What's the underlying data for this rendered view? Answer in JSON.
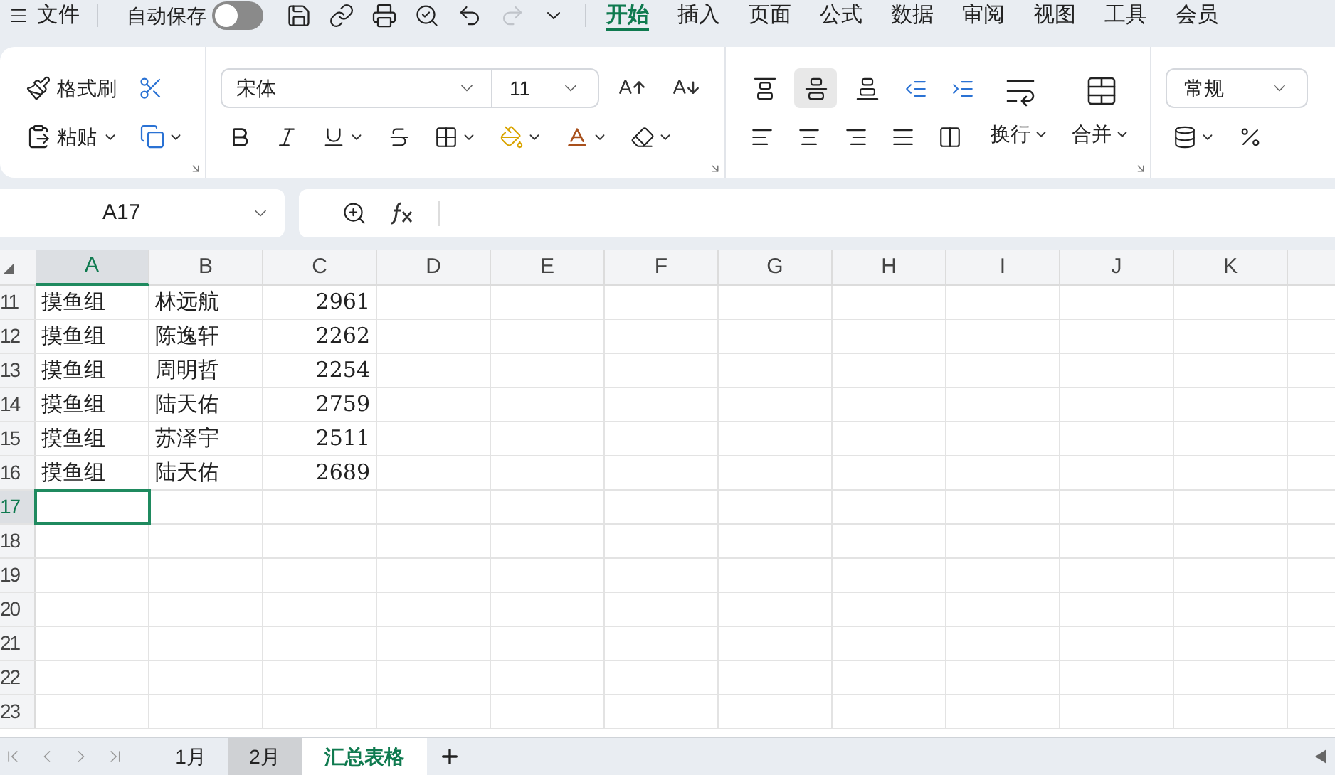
{
  "menu_bar": {
    "menu_label": "文件",
    "autosave": {
      "label": "自动保存",
      "on": false
    },
    "tabs": [
      {
        "label": "开始",
        "selected": true
      },
      {
        "label": "插入",
        "selected": false
      },
      {
        "label": "页面",
        "selected": false
      },
      {
        "label": "公式",
        "selected": false
      },
      {
        "label": "数据",
        "selected": false
      },
      {
        "label": "审阅",
        "selected": false
      },
      {
        "label": "视图",
        "selected": false
      },
      {
        "label": "工具",
        "selected": false
      },
      {
        "label": "会员",
        "selected": false
      }
    ]
  },
  "ribbon": {
    "format_painter": "格式刷",
    "paste": "粘贴",
    "font": "宋体",
    "font_size": "11",
    "vertical_align": [
      {
        "kind": "top",
        "selected": false
      },
      {
        "kind": "middle",
        "selected": true
      },
      {
        "kind": "bottom",
        "selected": false
      }
    ],
    "wrap": "换行",
    "merge": "合并",
    "number_format": "常规"
  },
  "formula_bar": {
    "name_box": "A17"
  },
  "sheet": {
    "columns": [
      {
        "label": "A",
        "selected": true
      },
      {
        "label": "B",
        "selected": false
      },
      {
        "label": "C",
        "selected": false
      },
      {
        "label": "D",
        "selected": false
      },
      {
        "label": "E",
        "selected": false
      },
      {
        "label": "F",
        "selected": false
      },
      {
        "label": "G",
        "selected": false
      },
      {
        "label": "H",
        "selected": false
      },
      {
        "label": "I",
        "selected": false
      },
      {
        "label": "J",
        "selected": false
      },
      {
        "label": "K",
        "selected": false
      }
    ],
    "rows": [
      {
        "number": "11",
        "selected": false,
        "cells": [
          "摸鱼组",
          "林远航",
          "2961"
        ]
      },
      {
        "number": "12",
        "selected": false,
        "cells": [
          "摸鱼组",
          "陈逸轩",
          "2262"
        ]
      },
      {
        "number": "13",
        "selected": false,
        "cells": [
          "摸鱼组",
          "周明哲",
          "2254"
        ]
      },
      {
        "number": "14",
        "selected": false,
        "cells": [
          "摸鱼组",
          "陆天佑",
          "2759"
        ]
      },
      {
        "number": "15",
        "selected": false,
        "cells": [
          "摸鱼组",
          "苏泽宇",
          "2511"
        ]
      },
      {
        "number": "16",
        "selected": false,
        "cells": [
          "摸鱼组",
          "陆天佑",
          "2689"
        ]
      },
      {
        "number": "17",
        "selected": true,
        "cells": []
      },
      {
        "number": "18",
        "selected": false,
        "cells": []
      },
      {
        "number": "19",
        "selected": false,
        "cells": []
      },
      {
        "number": "20",
        "selected": false,
        "cells": []
      },
      {
        "number": "21",
        "selected": false,
        "cells": []
      },
      {
        "number": "22",
        "selected": false,
        "cells": []
      },
      {
        "number": "23",
        "selected": false,
        "cells": []
      }
    ]
  },
  "sheet_tabs": [
    {
      "label": "1月",
      "selected": false,
      "hovered": false
    },
    {
      "label": "2月",
      "selected": false,
      "hovered": true
    },
    {
      "label": "汇总表格",
      "selected": true,
      "hovered": false
    }
  ]
}
